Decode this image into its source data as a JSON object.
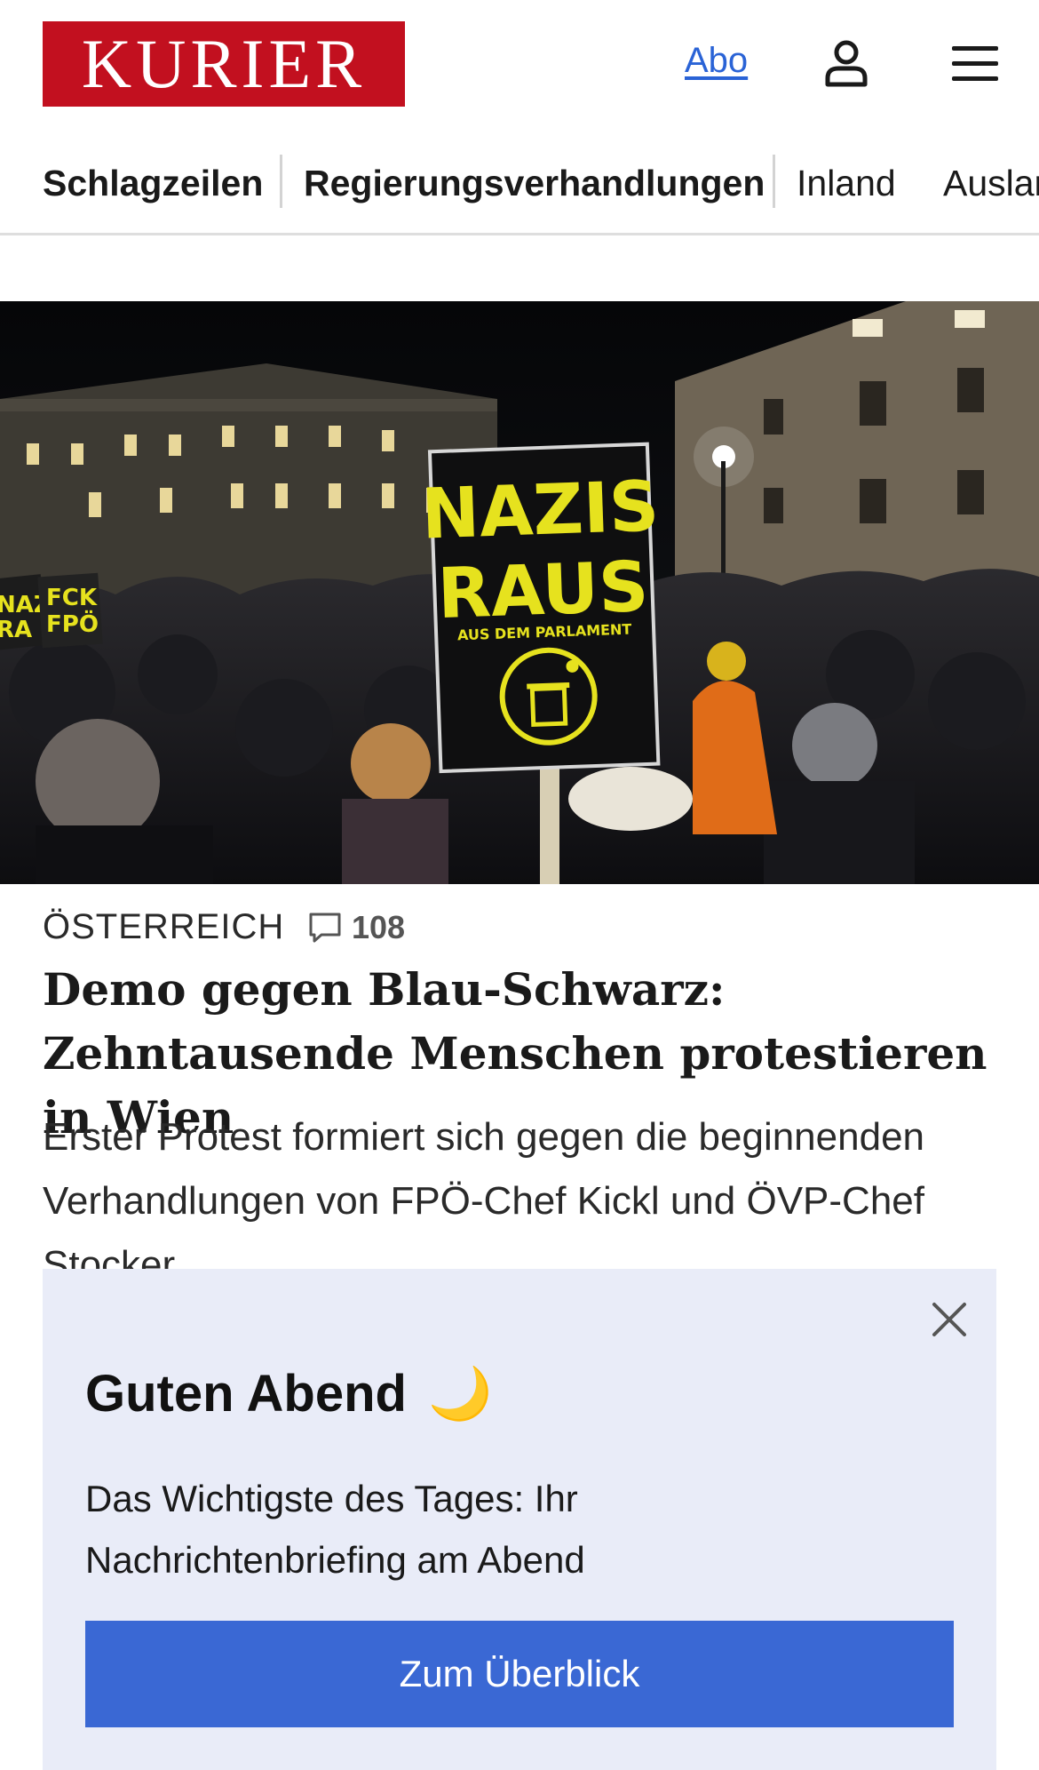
{
  "header": {
    "logo_text": "KURIER",
    "abo_label": "Abo",
    "user_icon": "user-icon",
    "menu_icon": "hamburger-menu-icon"
  },
  "nav": {
    "items": [
      {
        "label": "Schlagzeilen"
      },
      {
        "label": "Regierungsverhandlungen"
      },
      {
        "label": "Inland"
      },
      {
        "label": "Ausland"
      }
    ]
  },
  "hero": {
    "sign_line1": "NAZIS",
    "sign_line2": "RAUS",
    "sign_line3": "AUS DEM PARLAMENT",
    "left_sign_a": "NAZ",
    "left_sign_b": "RA",
    "left_sign_c": "FCK",
    "left_sign_d": "FPÖ"
  },
  "article": {
    "kicker": "ÖSTERREICH",
    "comment_count": "108",
    "headline": "Demo gegen Blau-Schwarz: Zehntausende Menschen protestieren in Wien",
    "teaser": "Erster Protest formiert sich gegen die beginnenden Verhandlungen von FPÖ-Chef Kickl und ÖVP-Chef Stocker"
  },
  "popup": {
    "title": "Guten Abend",
    "emoji": "🌙",
    "text": "Das Wichtigste des Tages: Ihr Nachrichtenbriefing am Abend",
    "button_label": "Zum Überblick"
  },
  "colors": {
    "brand_red": "#c2101f",
    "link_blue": "#2a63d6",
    "popup_bg": "#e9ecf8",
    "cta_blue": "#3a68d4",
    "sign_yellow": "#e6e21e"
  }
}
